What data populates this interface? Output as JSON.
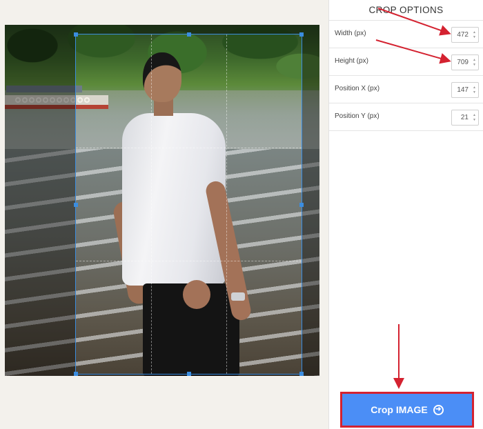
{
  "panel": {
    "title": "CROP OPTIONS",
    "options": [
      {
        "label": "Width (px)",
        "value": "472"
      },
      {
        "label": "Height (px)",
        "value": "709"
      },
      {
        "label": "Position X (px)",
        "value": "147"
      },
      {
        "label": "Position Y (px)",
        "value": "21"
      }
    ]
  },
  "crop_button": {
    "label": "Crop IMAGE",
    "icon": "arrow-circle-right-icon"
  },
  "colors": {
    "button_bg": "#4b8ef6",
    "button_border": "#d42230",
    "crop_frame": "#3b8de0",
    "annotation_arrow": "#d42230"
  },
  "icons": {
    "spinner_up": "▲",
    "spinner_down": "▼",
    "button_arrow": "➜"
  }
}
